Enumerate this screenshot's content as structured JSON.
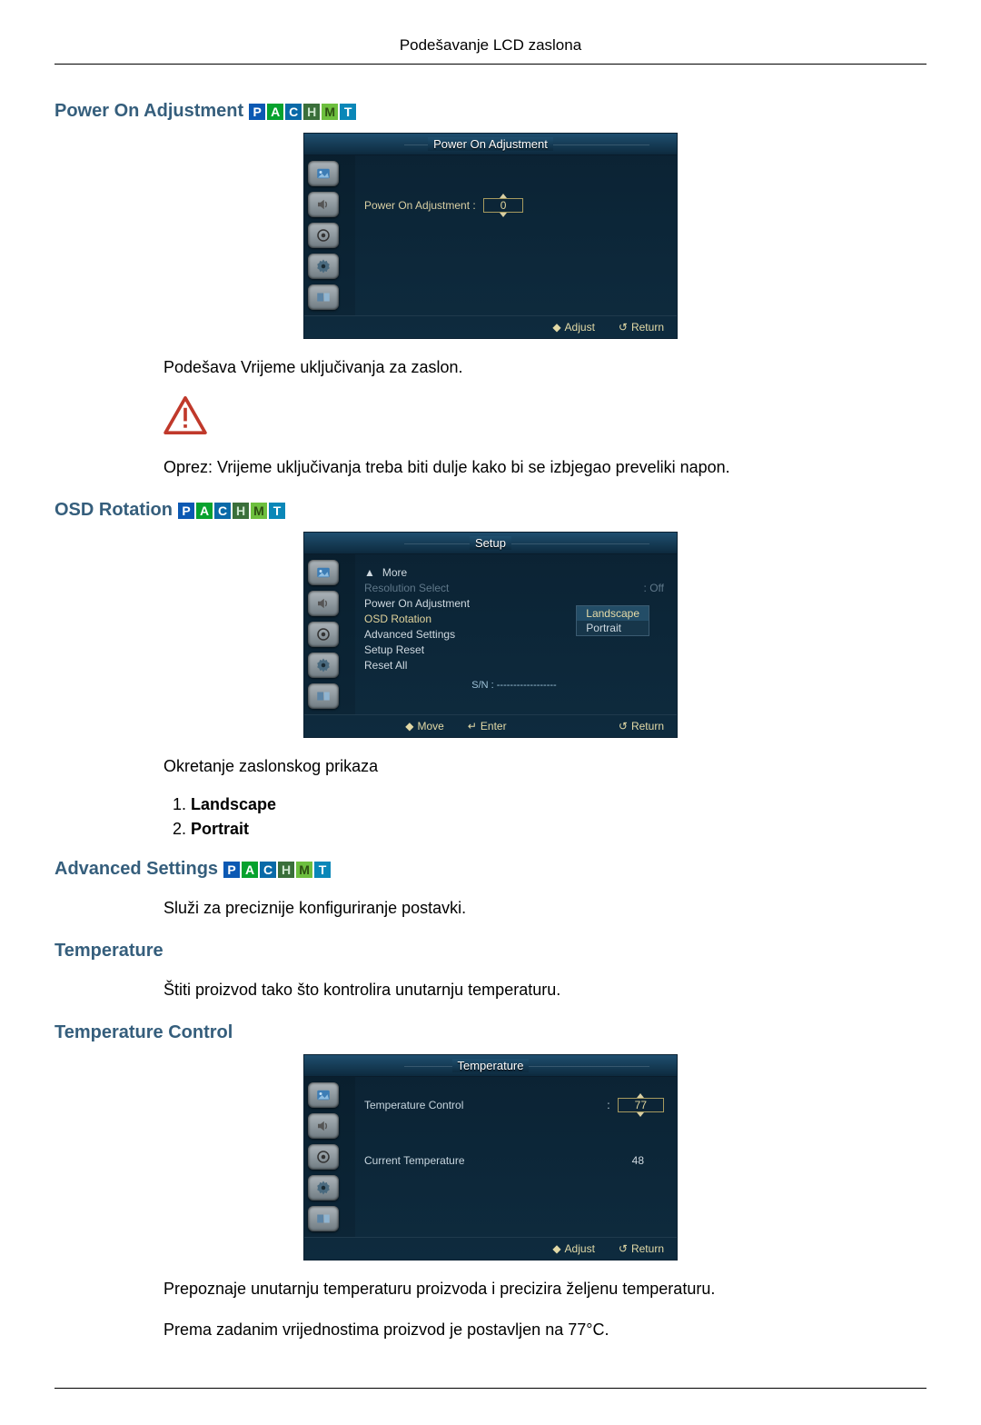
{
  "page_header": "Podešavanje LCD zaslona",
  "badges": {
    "p": "P",
    "a": "A",
    "c": "C",
    "h": "H",
    "m": "M",
    "t": "T"
  },
  "sections": {
    "power_on": {
      "title": "Power On Adjustment",
      "osd_title": "Power On Adjustment",
      "row_label": "Power On Adjustment :",
      "row_value": "0",
      "footer_adjust": "Adjust",
      "footer_return": "Return",
      "text1": "Podešava Vrijeme uključivanja za zaslon.",
      "text2": "Oprez: Vrijeme uključivanja treba biti dulje kako bi se izbjegao preveliki napon."
    },
    "osd_rotation": {
      "title": "OSD Rotation",
      "osd_title": "Setup",
      "menu": {
        "more": "More",
        "resolution_select": "Resolution Select",
        "resolution_value": ": Off",
        "power_on": "Power On Adjustment",
        "osd_rotation": "OSD Rotation",
        "advanced": "Advanced Settings",
        "setup_reset": "Setup Reset",
        "reset_all": "Reset All",
        "sn": "S/N : ------------------"
      },
      "submenu": {
        "landscape": "Landscape",
        "portrait": "Portrait"
      },
      "footer_move": "Move",
      "footer_enter": "Enter",
      "footer_return": "Return",
      "text": "Okretanje zaslonskog prikaza",
      "opt1": "Landscape",
      "opt2": "Portrait"
    },
    "advanced": {
      "title": "Advanced Settings",
      "text": "Služi za preciznije konfiguriranje postavki."
    },
    "temperature": {
      "title": "Temperature",
      "text": "Štiti proizvod tako što kontrolira unutarnju temperaturu."
    },
    "temp_control": {
      "title": "Temperature Control",
      "osd_title": "Temperature",
      "row1_label": "Temperature Control",
      "row1_value": "77",
      "row2_label": "Current Temperature",
      "row2_value": "48",
      "footer_adjust": "Adjust",
      "footer_return": "Return",
      "text1": "Prepoznaje unutarnju temperaturu proizvoda i precizira željenu temperaturu.",
      "text2": "Prema zadanim vrijednostima proizvod je postavljen na 77°C."
    }
  }
}
